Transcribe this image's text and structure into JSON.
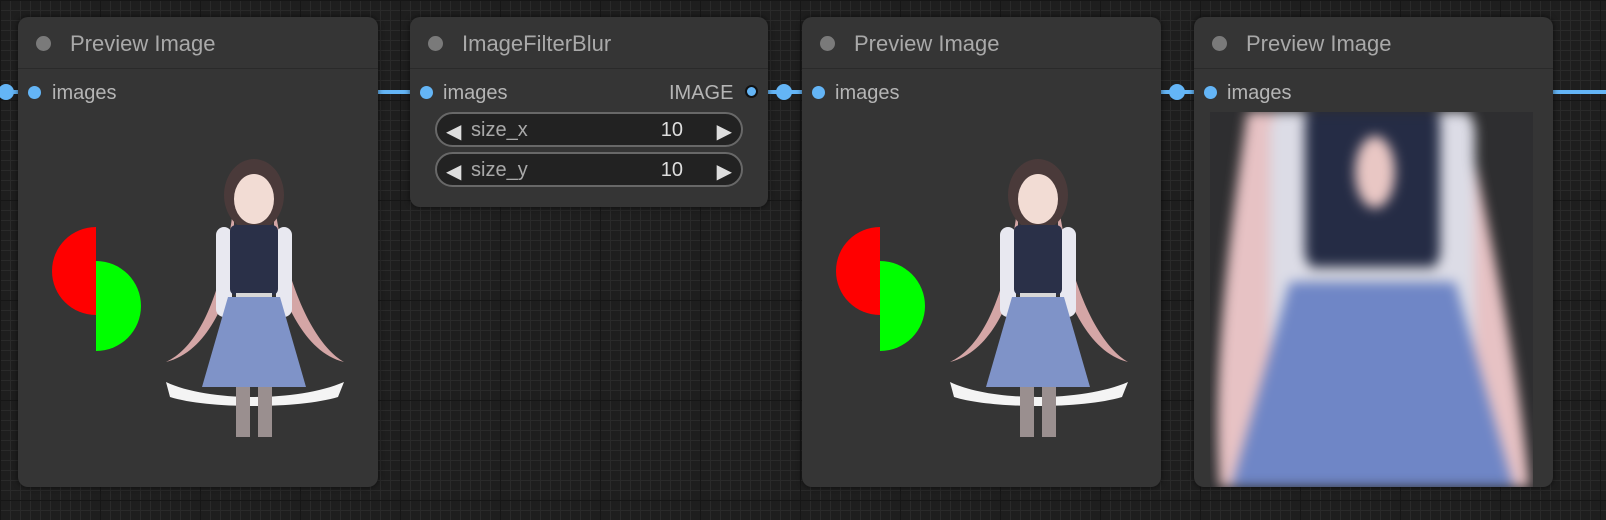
{
  "nodes": [
    {
      "title": "Preview Image",
      "inputs": [
        {
          "label": "images"
        }
      ]
    },
    {
      "title": "ImageFilterBlur",
      "inputs": [
        {
          "label": "images"
        }
      ],
      "outputs": [
        {
          "label": "IMAGE"
        }
      ],
      "widgets": [
        {
          "label": "size_x",
          "value": "10"
        },
        {
          "label": "size_y",
          "value": "10"
        }
      ]
    },
    {
      "title": "Preview Image",
      "inputs": [
        {
          "label": "images"
        }
      ]
    },
    {
      "title": "Preview Image",
      "inputs": [
        {
          "label": "images"
        }
      ]
    }
  ],
  "icons": {
    "arrow_left": "◀",
    "arrow_right": "▶"
  },
  "colors": {
    "wire": "#64b5f6",
    "half_circle_red": "#ff0000",
    "half_circle_green": "#00ff00"
  }
}
